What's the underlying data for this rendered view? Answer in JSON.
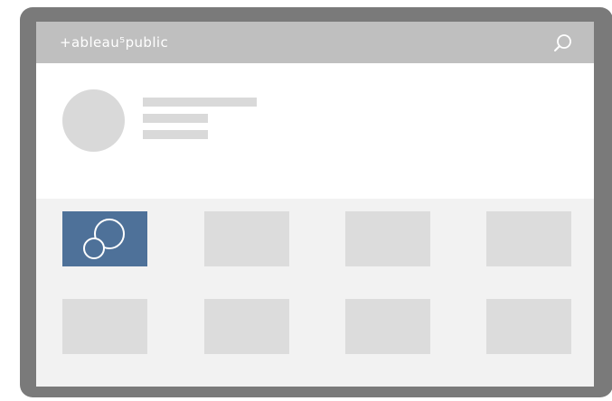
{
  "header": {
    "brand_text": "+ableau⁵public",
    "search_icon": "search-icon"
  },
  "profile": {
    "avatar_icon": "avatar-placeholder",
    "text_lines": 3
  },
  "gallery": {
    "rows": 2,
    "columns": 4,
    "active_tile_icon": "overlapping-circles-icon",
    "colors": {
      "active": "#4e7199",
      "placeholder": "#dcdcdc",
      "topbar": "#bfbfbf",
      "bezel": "#7a7a7a"
    }
  }
}
